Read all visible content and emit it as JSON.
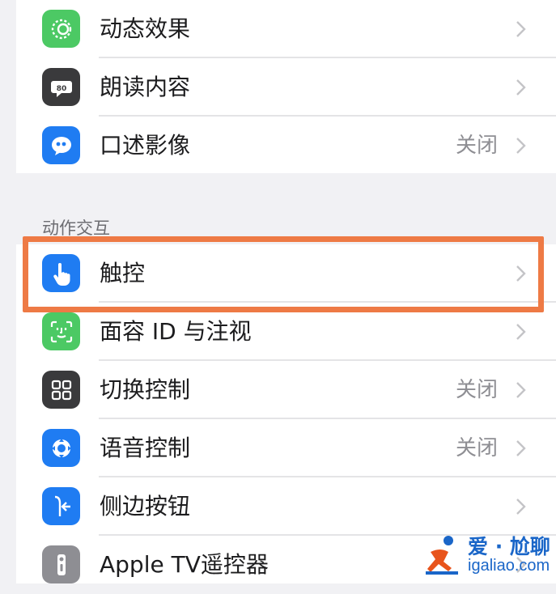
{
  "colors": {
    "accent_highlight": "#ee7a45",
    "green_icon": "#34c759",
    "dark_icon": "#3a3a3c",
    "blue_icon": "#1f7cf2",
    "value_gray": "#8e8e93"
  },
  "group1": {
    "rows": [
      {
        "label": "动态效果",
        "value": "",
        "icon": "motion-icon"
      },
      {
        "label": "朗读内容",
        "value": "",
        "icon": "speech-bubble-icon"
      },
      {
        "label": "口述影像",
        "value": "关闭",
        "icon": "audio-description-icon"
      }
    ]
  },
  "section": {
    "header": "动作交互"
  },
  "group2": {
    "rows": [
      {
        "label": "触控",
        "value": "",
        "icon": "hand-pointer-icon"
      },
      {
        "label": "面容 ID 与注视",
        "value": "",
        "icon": "face-id-icon"
      },
      {
        "label": "切换控制",
        "value": "关闭",
        "icon": "grid-icon"
      },
      {
        "label": "语音控制",
        "value": "关闭",
        "icon": "voice-control-icon"
      },
      {
        "label": "侧边按钮",
        "value": "",
        "icon": "side-button-icon"
      },
      {
        "label": "Apple TV遥控器",
        "value": "",
        "icon": "remote-icon"
      }
    ]
  },
  "watermark": {
    "title": "爱 · 尬聊",
    "url": "igaliao.com"
  }
}
